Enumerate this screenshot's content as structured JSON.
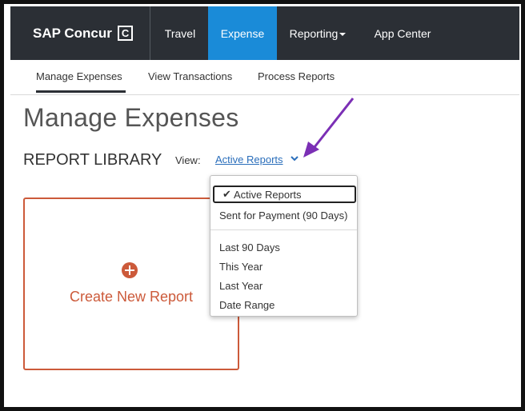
{
  "topbar": {
    "brand": "SAP Concur",
    "brand_logo_letter": "C",
    "nav": [
      {
        "label": "Travel"
      },
      {
        "label": "Expense",
        "active": true
      },
      {
        "label": "Reporting"
      },
      {
        "label": "App Center"
      }
    ]
  },
  "subnav": {
    "items": [
      {
        "label": "Manage Expenses",
        "active": true
      },
      {
        "label": "View Transactions"
      },
      {
        "label": "Process Reports"
      }
    ]
  },
  "main": {
    "page_title": "Manage Expenses",
    "library_title": "REPORT LIBRARY",
    "view_label": "View:",
    "view_selected": "Active Reports",
    "create_card": {
      "label": "Create New Report"
    }
  },
  "dropdown": {
    "options_group1": [
      "Active Reports",
      "Sent for Payment (90 Days)"
    ],
    "options_group2": [
      "Last 90 Days",
      "This Year",
      "Last Year",
      "Date Range"
    ],
    "selected": "Active Reports"
  },
  "colors": {
    "topbar_bg": "#2b2f35",
    "active_tab": "#1a8bd8",
    "link": "#2a6ebb",
    "create_accent": "#cc5a3a",
    "annotation_arrow": "#7b2fb5"
  },
  "icons": {
    "brand_logo": "concur-c-logo",
    "reporting_caret": "caret-down-icon",
    "view_chevron": "chevron-down-icon",
    "create_plus": "plus-circle-icon",
    "selected_check": "checkmark-icon",
    "annotation": "arrow-annotation"
  }
}
